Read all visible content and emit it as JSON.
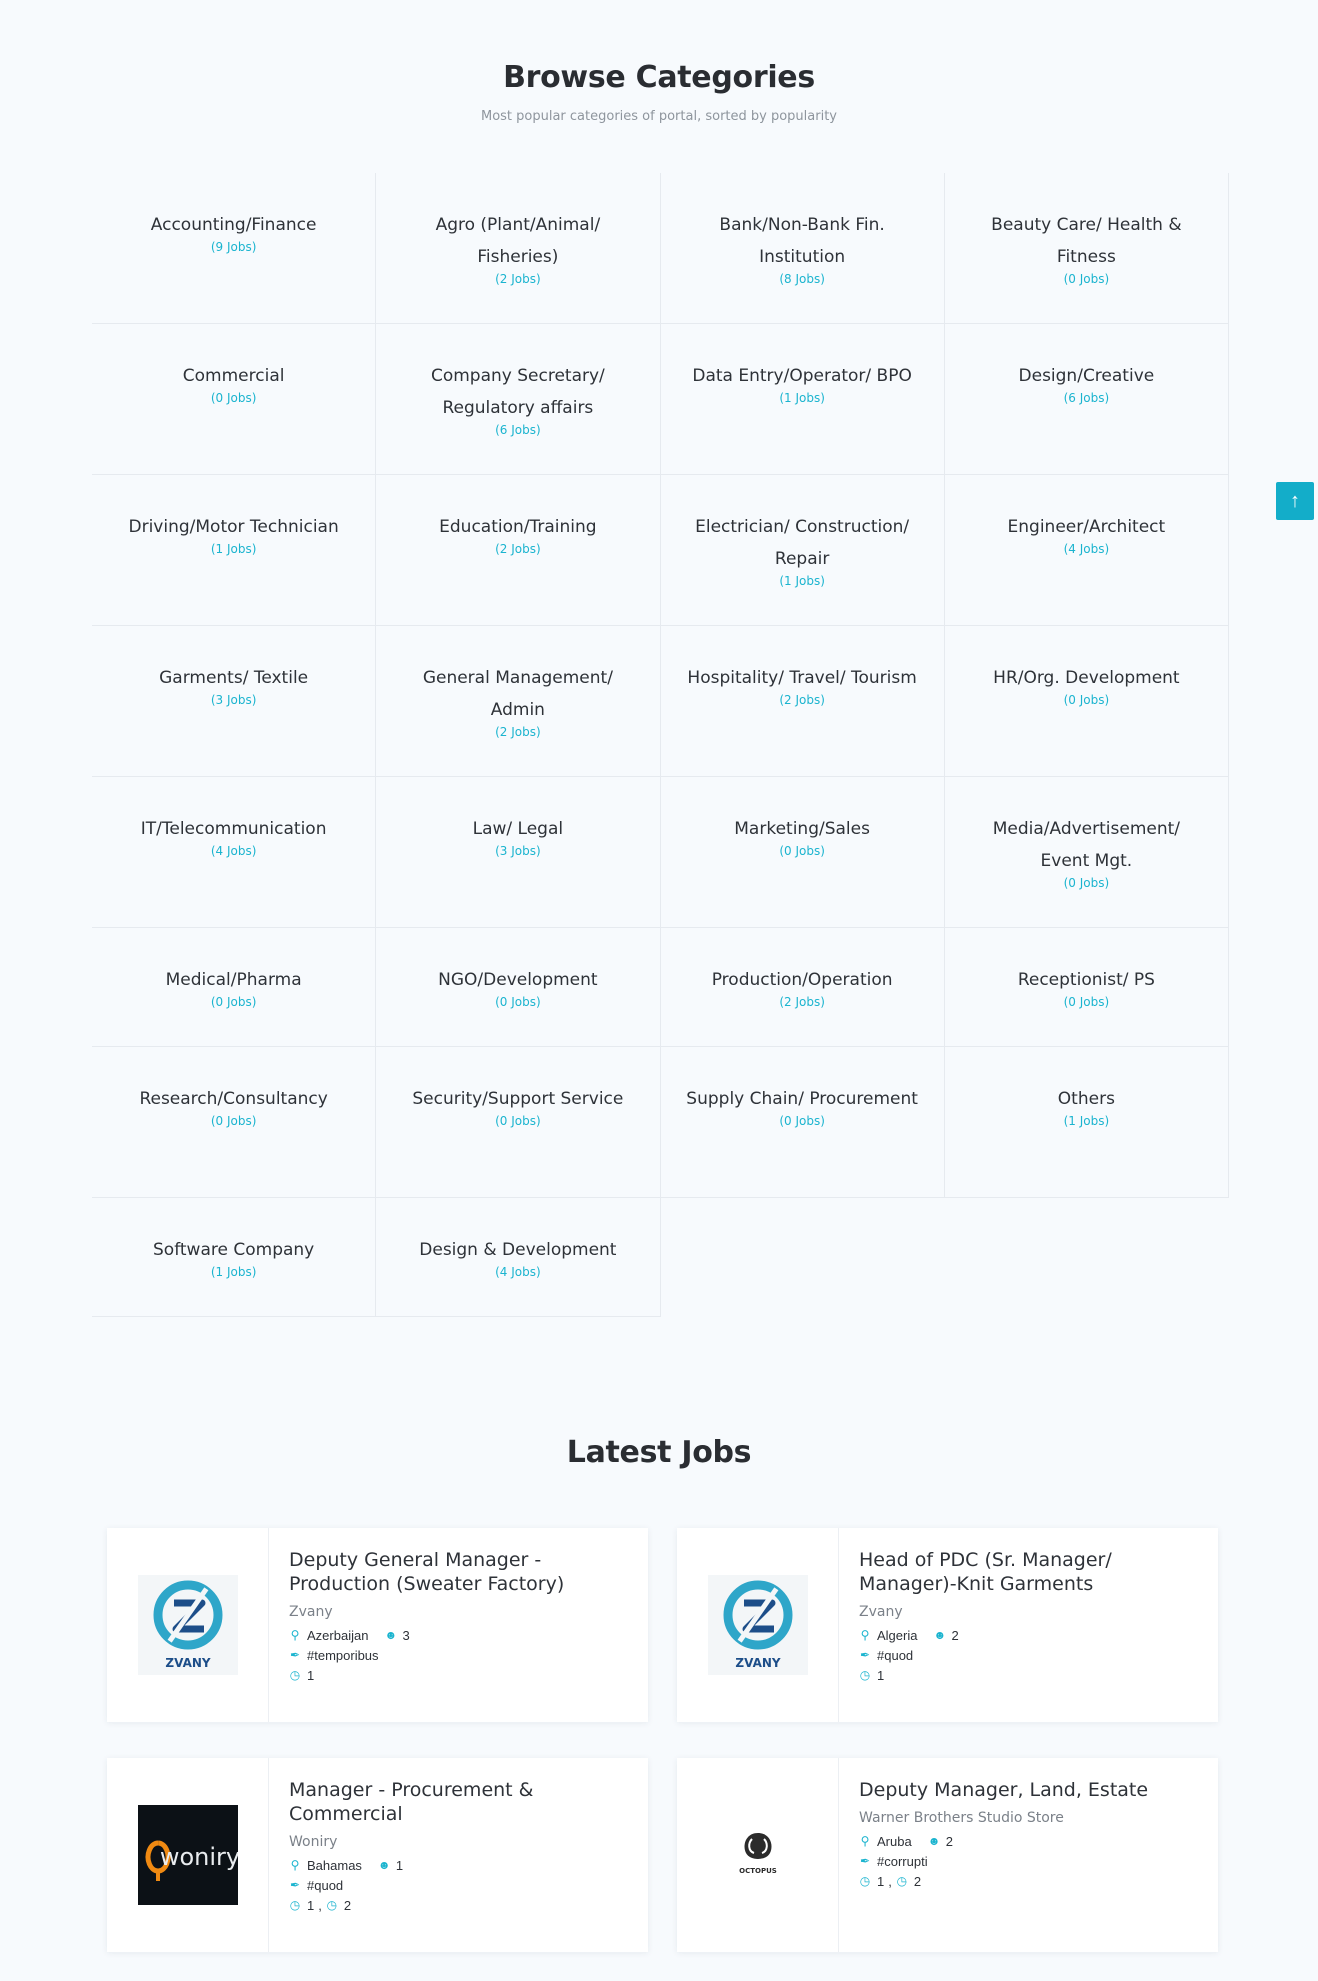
{
  "browse": {
    "title": "Browse Categories",
    "subtitle": "Most popular categories of portal, sorted by popularity"
  },
  "categories": [
    {
      "name": "Accounting/Finance",
      "count": "(9 Jobs)"
    },
    {
      "name": "Agro (Plant/Animal/ Fisheries)",
      "count": "(2 Jobs)"
    },
    {
      "name": "Bank/Non-Bank Fin. Institution",
      "count": "(8 Jobs)"
    },
    {
      "name": "Beauty Care/ Health & Fitness",
      "count": "(0 Jobs)"
    },
    {
      "name": "Commercial",
      "count": "(0 Jobs)"
    },
    {
      "name": "Company Secretary/ Regulatory affairs",
      "count": "(6 Jobs)"
    },
    {
      "name": "Data Entry/Operator/ BPO",
      "count": "(1 Jobs)"
    },
    {
      "name": "Design/Creative",
      "count": "(6 Jobs)"
    },
    {
      "name": "Driving/Motor Technician",
      "count": "(1 Jobs)"
    },
    {
      "name": "Education/Training",
      "count": "(2 Jobs)"
    },
    {
      "name": "Electrician/ Construction/ Repair",
      "count": "(1 Jobs)"
    },
    {
      "name": "Engineer/Architect",
      "count": "(4 Jobs)"
    },
    {
      "name": "Garments/ Textile",
      "count": "(3 Jobs)"
    },
    {
      "name": "General Management/ Admin",
      "count": "(2 Jobs)"
    },
    {
      "name": "Hospitality/ Travel/ Tourism",
      "count": "(2 Jobs)"
    },
    {
      "name": "HR/Org. Development",
      "count": "(0 Jobs)"
    },
    {
      "name": "IT/Telecommunication",
      "count": "(4 Jobs)"
    },
    {
      "name": "Law/ Legal",
      "count": "(3 Jobs)"
    },
    {
      "name": "Marketing/Sales",
      "count": "(0 Jobs)"
    },
    {
      "name": "Media/Advertisement/ Event Mgt.",
      "count": "(0 Jobs)"
    },
    {
      "name": "Medical/Pharma",
      "count": "(0 Jobs)"
    },
    {
      "name": "NGO/Development",
      "count": "(0 Jobs)"
    },
    {
      "name": "Production/Operation",
      "count": "(2 Jobs)"
    },
    {
      "name": "Receptionist/ PS",
      "count": "(0 Jobs)"
    },
    {
      "name": "Research/Consultancy",
      "count": "(0 Jobs)"
    },
    {
      "name": "Security/Support Service",
      "count": "(0 Jobs)"
    },
    {
      "name": "Supply Chain/ Procurement",
      "count": "(0 Jobs)"
    },
    {
      "name": "Others",
      "count": "(1 Jobs)"
    },
    {
      "name": "Software Company",
      "count": "(1 Jobs)"
    },
    {
      "name": "Design & Development",
      "count": "(4 Jobs)"
    }
  ],
  "latest": {
    "title": "Latest Jobs"
  },
  "jobs": [
    {
      "title": "Deputy General Manager - Production (Sweater Factory)",
      "company": "Zvany",
      "logo": "zvany-logo",
      "logo_text": "ZVANY",
      "location": "Azerbaijan",
      "vacancies": "3",
      "tag": "#temporibus",
      "times": [
        "1"
      ]
    },
    {
      "title": "Head of PDC (Sr. Manager/ Manager)-Knit Garments",
      "company": "Zvany",
      "logo": "zvany-logo",
      "logo_text": "ZVANY",
      "location": "Algeria",
      "vacancies": "2",
      "tag": "#quod",
      "times": [
        "1"
      ]
    },
    {
      "title": "Manager - Procurement & Commercial",
      "company": "Woniry",
      "logo": "woniry-logo",
      "logo_text": "woniry",
      "location": "Bahamas",
      "vacancies": "1",
      "tag": "#quod",
      "times": [
        "1",
        "2"
      ]
    },
    {
      "title": "Deputy Manager, Land, Estate",
      "company": "Warner Brothers Studio Store",
      "logo": "octopus-logo",
      "logo_text": "OCTOPUS",
      "location": "Aruba",
      "vacancies": "2",
      "tag": "#corrupti",
      "times": [
        "1",
        "2"
      ]
    }
  ],
  "colors": {
    "accent": "#1bb4cf",
    "background": "#f7fafd",
    "heading": "#2a2d32"
  },
  "icons": {
    "location": "map-pin-icon",
    "vacancies": "user-icon",
    "tag": "tag-icon",
    "time": "clock-icon",
    "scroll_top": "arrow-up-icon"
  }
}
